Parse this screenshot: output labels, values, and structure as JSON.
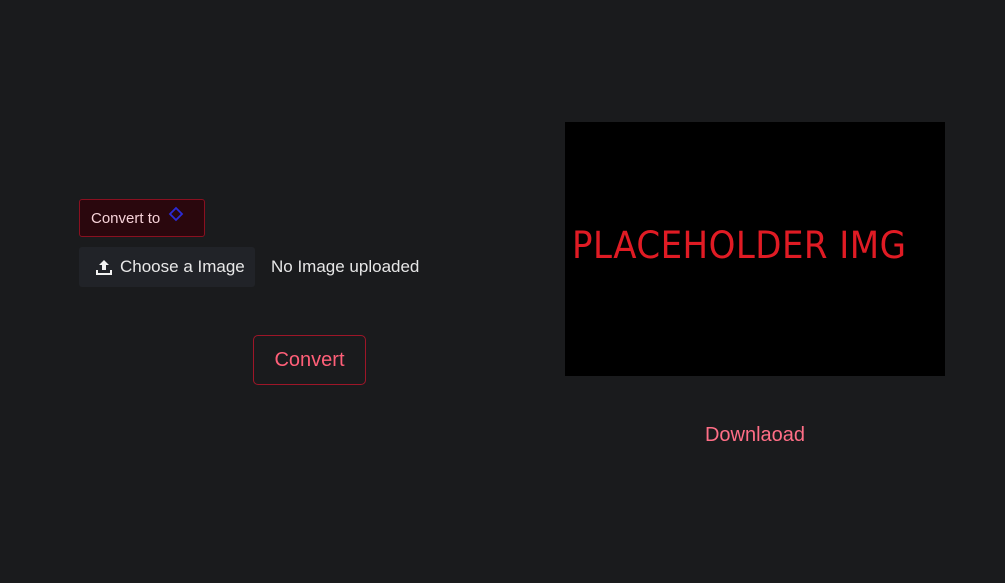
{
  "convert_to": {
    "label": "Convert to",
    "icon": "select-arrows-icon"
  },
  "file_input": {
    "button_label": "Choose a Image",
    "icon": "upload-icon",
    "status": "No Image uploaded"
  },
  "convert_button": {
    "label": "Convert"
  },
  "preview": {
    "placeholder_text": "PLACEHOLDER IMG"
  },
  "download": {
    "label": "Downlaoad"
  },
  "colors": {
    "background": "#1a1b1d",
    "accent": "#ff5f78",
    "accent_border": "#9d1628",
    "placeholder_text": "#e01b24"
  }
}
